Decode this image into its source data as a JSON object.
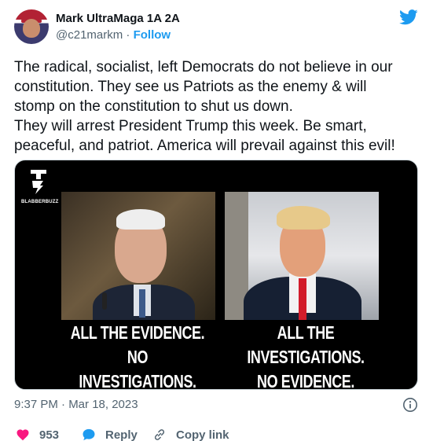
{
  "author": {
    "display_name": "Mark UltraMaga 1A 2A",
    "handle": "@c21markm",
    "separator": " · ",
    "follow_label": "Follow"
  },
  "tweet": {
    "text": "The radical, socialist, left  Democrats do not believe in our\nconstitution. They see us Patriots as the enemy & will\nstomp on the constitution to shut us down.\nThey will arrest President Trump this week.  Be smart,\npeaceful, and patriot. America will prevail against this evil!"
  },
  "media": {
    "logo_text": "BLABBERBUZZ",
    "caption_left_line1": "ALL THE EVIDENCE.",
    "caption_left_line2": "NO INVESTIGATIONS.",
    "caption_right_line1": "ALL THE INVESTIGATIONS.",
    "caption_right_line2": "NO EVIDENCE."
  },
  "timestamp": "9:37 PM · Mar 18, 2023",
  "actions": {
    "like_count": "953",
    "reply_label": "Reply",
    "copy_label": "Copy link"
  },
  "colors": {
    "accent": "#1d9bf0",
    "like": "#f91880",
    "muted": "#536471"
  },
  "icons": [
    "twitter-bird-icon",
    "info-icon",
    "heart-icon",
    "reply-bubble-icon",
    "link-icon"
  ]
}
